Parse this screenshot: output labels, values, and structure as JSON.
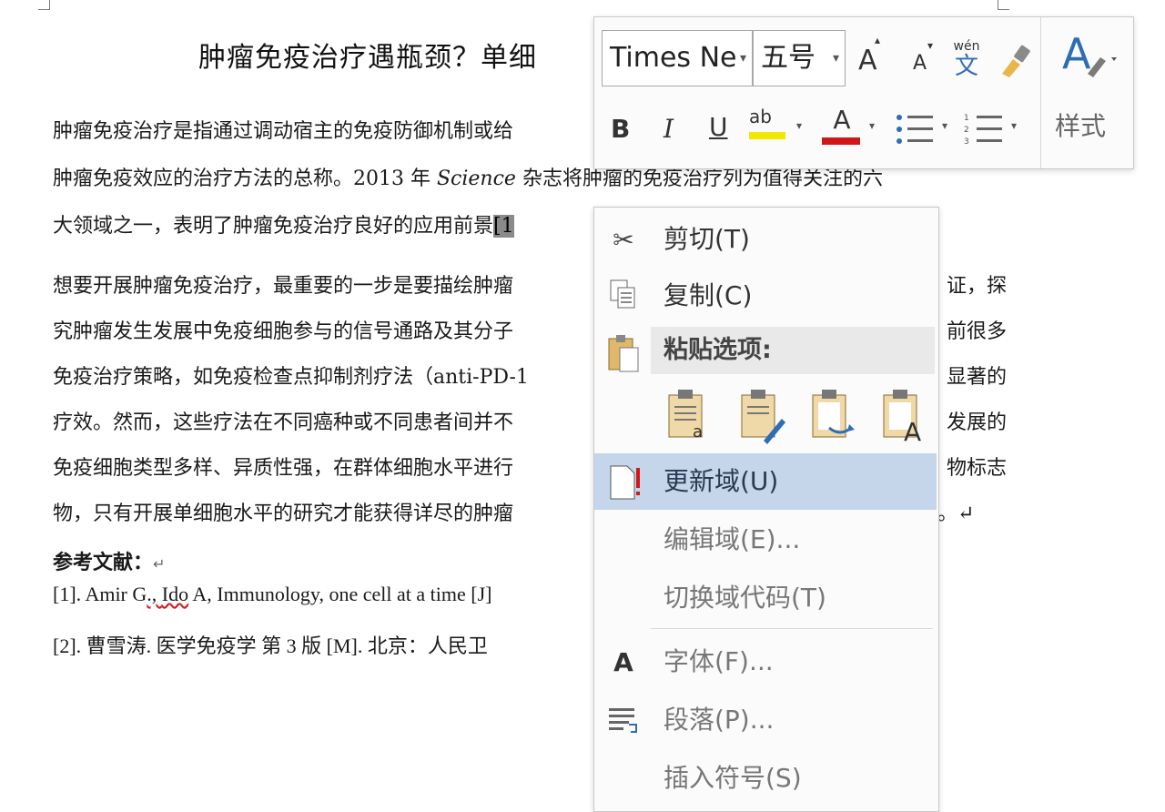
{
  "document": {
    "title": "肿瘤免疫治疗遇瓶颈？单细",
    "p1": {
      "l1": "肿瘤免疫治疗是指通过调动宿主的免疫防御机制或给",
      "l2a": "肿瘤免疫效应的治疗方法的总称。2013 年 ",
      "l2b": "Science",
      "l2c": " 杂志将肿瘤的免疫治疗列为值得关注的六",
      "l3a": "大领域之一，表明了肿瘤免疫治疗良好的应用前景",
      "l3b": "[1"
    },
    "p2": {
      "l1a": "想要开展肿瘤免疫治疗，最重要的一步是要描绘肿瘤",
      "l1b": "证，探",
      "l2a": "究肿瘤发生发展中免疫细胞参与的信号通路及其分子",
      "l2b": "前很多",
      "l3a": "免疫治疗策略，如免疫检查点抑制剂疗法（anti-PD-1",
      "l3b": "显著的",
      "l4a": "疗效。然而，这些疗法在不同癌种或不同患者间并不",
      "l4b": "发展的",
      "l5a": "免疫细胞类型多样、异质性强，在群体细胞水平进行",
      "l5b": "物标志",
      "l6a": "物，只有开展单细胞水平的研究才能获得详尽的肿瘤",
      "l6b": "。↵"
    },
    "refs_heading": "参考文献：",
    "refs_mark": "↵",
    "ref1a": "[1].  Amir G",
    "ref1b": "., ",
    "ref1c": "Ido",
    "ref1d": " A, Immunology, one cell at a time [J]",
    "ref2": "[2].  曹雪涛.  医学免疫学   第 3 版  [M].  北京：人民卫"
  },
  "toolbar": {
    "font_name": "Times Ne",
    "font_size": "五号",
    "grow_font": "A",
    "shrink_font": "A",
    "phonetic_top": "wén",
    "phonetic_bottom": "文",
    "bold": "B",
    "italic": "I",
    "underline": "U",
    "highlight": "ab",
    "font_color": "A",
    "styles_icon": "A",
    "styles_label": "样式",
    "colors": {
      "highlight": "#f5e600",
      "font_color": "#d01818",
      "styles_blue": "#2e6db4"
    }
  },
  "context_menu": {
    "cut": "剪切(T)",
    "copy": "复制(C)",
    "paste_options": "粘贴选项:",
    "update_field": "更新域(U)",
    "edit_field": "编辑域(E)...",
    "toggle_field_codes": "切换域代码(T)",
    "font": "字体(F)...",
    "paragraph": "段落(P)...",
    "insert_symbol": "插入符号(S)",
    "font_icon": "A"
  }
}
